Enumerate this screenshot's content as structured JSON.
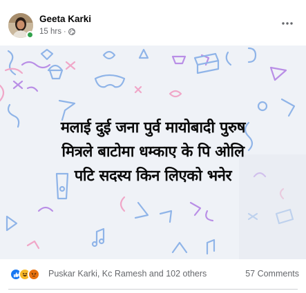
{
  "post": {
    "author": "Geeta Karki",
    "time": "15 hrs",
    "separator": "·",
    "privacy_icon": "globe-icon",
    "more_icon": "more-horizontal-icon",
    "text_lines": [
      "मलाई दुई जना पुर्व मायोबादी पुरुष",
      "मित्रले बाटोमा धम्काए के पि ओलि",
      "पटि सदस्य किन लिएको भनेर"
    ],
    "background_theme": "party-doodles"
  },
  "reactions": {
    "types": [
      "like",
      "haha",
      "angry"
    ],
    "names_text": "Puskar Karki, Kc Ramesh and 102 others",
    "comments_text": "57 Comments"
  },
  "colors": {
    "like": "#1877f2",
    "haha": "#f7b928",
    "angry": "#e9710f",
    "secondary_text": "#65676b",
    "online": "#31a24c",
    "image_bg": "#eff2f7"
  }
}
